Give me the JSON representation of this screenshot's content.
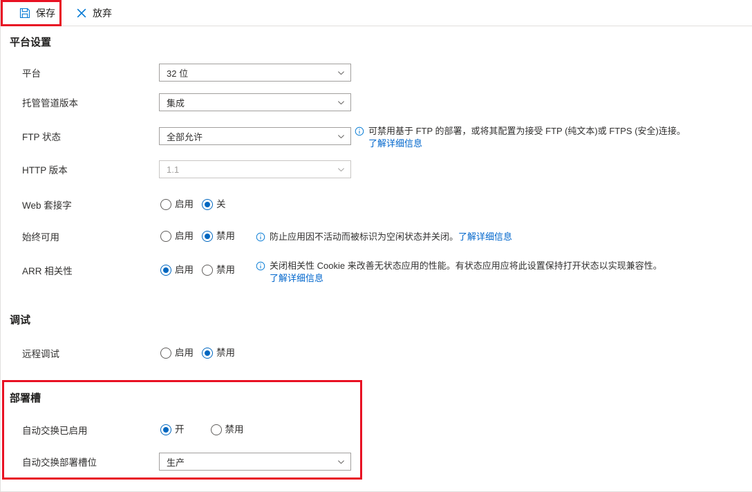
{
  "toolbar": {
    "save": {
      "label": "保存",
      "icon": "save-icon"
    },
    "discard": {
      "label": "放弃",
      "icon": "close-icon"
    }
  },
  "highlight_color": "#e81123",
  "accent_color": "#0078d4",
  "sections": {
    "platform": {
      "title": "平台设置",
      "rows": {
        "platform": {
          "label": "平台",
          "value": "32 位"
        },
        "pipeline": {
          "label": "托管管道版本",
          "value": "集成"
        },
        "ftp": {
          "label": "FTP 状态",
          "value": "全部允许",
          "info": "可禁用基于 FTP 的部署，或将其配置为接受 FTP (纯文本)或 FTPS (安全)连接。",
          "info_link": "了解详细信息"
        },
        "http": {
          "label": "HTTP 版本",
          "value": "1.1"
        },
        "websockets": {
          "label": "Web 套接字",
          "options": [
            "启用",
            "关"
          ],
          "selected": "关"
        },
        "always_on": {
          "label": "始终可用",
          "options": [
            "启用",
            "禁用"
          ],
          "selected": "禁用",
          "info": "防止应用因不活动而被标识为空闲状态并关闭。",
          "info_link": "了解详细信息"
        },
        "arr": {
          "label": "ARR 相关性",
          "options": [
            "启用",
            "禁用"
          ],
          "selected": "启用",
          "info": "关闭相关性 Cookie 来改善无状态应用的性能。有状态应用应将此设置保持打开状态以实现兼容性。",
          "info_link": "了解详细信息"
        }
      }
    },
    "debug": {
      "title": "调试",
      "rows": {
        "remote_debug": {
          "label": "远程调试",
          "options": [
            "启用",
            "禁用"
          ],
          "selected": "禁用"
        }
      }
    },
    "slot": {
      "title": "部署槽",
      "rows": {
        "auto_swap_enabled": {
          "label": "自动交换已启用",
          "options": [
            "开",
            "禁用"
          ],
          "selected": "开"
        },
        "auto_swap_slot": {
          "label": "自动交换部署槽位",
          "value": "生产"
        }
      }
    }
  }
}
